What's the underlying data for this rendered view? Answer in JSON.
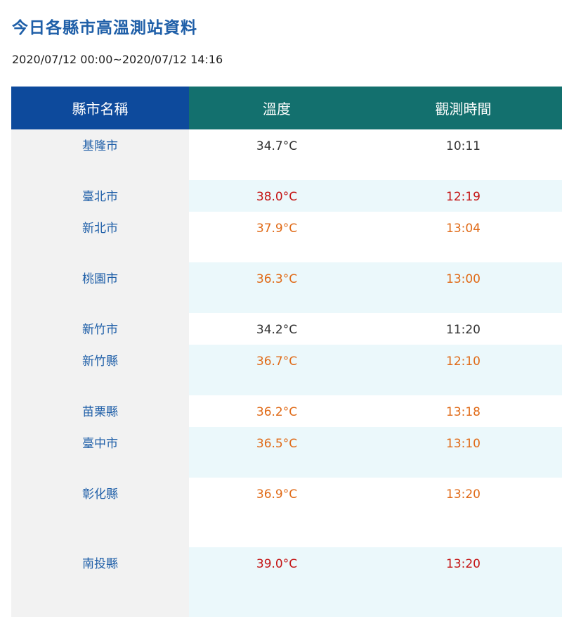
{
  "title": "今日各縣市高溫測站資料",
  "date_range": "2020/07/12 00:00~2020/07/12 14:16",
  "table": {
    "headers": [
      "縣市名稱",
      "溫度",
      "觀測時間"
    ],
    "rows": [
      {
        "county": "基隆市",
        "temp": "34.7°C",
        "time": "10:11",
        "level": "normal",
        "bg": "white",
        "height": 72
      },
      {
        "county": "臺北市",
        "temp": "38.0°C",
        "time": "12:19",
        "level": "red",
        "bg": "light",
        "height": 45
      },
      {
        "county": "新北市",
        "temp": "37.9°C",
        "time": "13:04",
        "level": "orange",
        "bg": "white",
        "height": 72
      },
      {
        "county": "桃園市",
        "temp": "36.3°C",
        "time": "13:00",
        "level": "orange",
        "bg": "light",
        "height": 72
      },
      {
        "county": "新竹市",
        "temp": "34.2°C",
        "time": "11:20",
        "level": "normal",
        "bg": "white",
        "height": 45
      },
      {
        "county": "新竹縣",
        "temp": "36.7°C",
        "time": "12:10",
        "level": "orange",
        "bg": "light",
        "height": 72
      },
      {
        "county": "苗栗縣",
        "temp": "36.2°C",
        "time": "13:18",
        "level": "orange",
        "bg": "white",
        "height": 45
      },
      {
        "county": "臺中市",
        "temp": "36.5°C",
        "time": "13:10",
        "level": "orange",
        "bg": "light",
        "height": 72
      },
      {
        "county": "彰化縣",
        "temp": "36.9°C",
        "time": "13:20",
        "level": "orange",
        "bg": "white",
        "height": 99
      },
      {
        "county": "南投縣",
        "temp": "39.0°C",
        "time": "13:20",
        "level": "red",
        "bg": "light",
        "height": 99
      }
    ]
  },
  "colors": {
    "title": "#1f5fa8",
    "header_county": "#0d4a9c",
    "header_teal": "#13706e",
    "row_light": "#ebf8fb",
    "county_bg": "#f2f2f2",
    "temp_orange": "#e06a17",
    "temp_red": "#c41414"
  }
}
